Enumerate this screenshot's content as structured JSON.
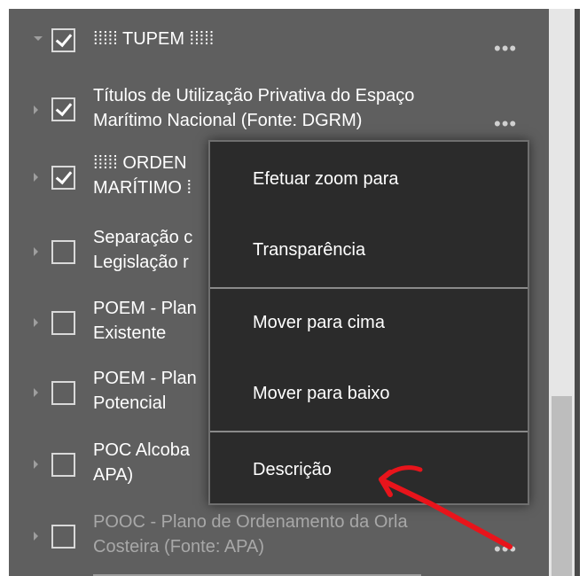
{
  "layers": [
    {
      "label": "⁞⁞⁞⁞⁞ TUPEM ⁞⁞⁞⁞⁞",
      "checked": true,
      "expanded": true,
      "muted": false,
      "more": "•••"
    },
    {
      "label": "Títulos de Utilização Privativa do Espaço\nMarítimo Nacional (Fonte: DGRM)",
      "checked": true,
      "expanded": false,
      "muted": false,
      "more": "•••"
    },
    {
      "label": "⁞⁞⁞⁞⁞ ORDEN\nMARÍTIMO ⁞",
      "checked": true,
      "expanded": false,
      "muted": false
    },
    {
      "label": "Separação c\nLegislação r",
      "checked": false,
      "expanded": false,
      "muted": false
    },
    {
      "label": "POEM - Plan\nExistente",
      "checked": false,
      "expanded": false,
      "muted": false
    },
    {
      "label": "POEM - Plan\nPotencial",
      "checked": false,
      "expanded": false,
      "muted": false
    },
    {
      "label": "POC Alcoba\nAPA)",
      "checked": false,
      "expanded": false,
      "muted": false
    },
    {
      "label": "POOC - Plano de Ordenamento da Orla\nCosteira (Fonte: APA)",
      "checked": false,
      "expanded": false,
      "muted": true,
      "more": "•••"
    }
  ],
  "context_menu": {
    "items": [
      {
        "label": "Efetuar zoom para"
      },
      {
        "label": "Transparência"
      },
      {
        "label": "Mover para cima"
      },
      {
        "label": "Mover para baixo"
      },
      {
        "label": "Descrição"
      }
    ]
  },
  "annotation": {
    "type": "red-arrow",
    "color": "#e8141b",
    "points_to": "Descrição"
  }
}
